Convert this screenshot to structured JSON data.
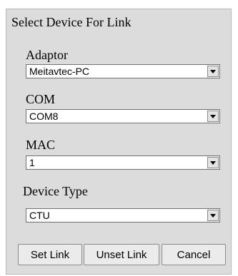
{
  "dialog": {
    "title": "Select Device For Link"
  },
  "fields": [
    {
      "label": "Adaptor",
      "value": "Meitavtec-PC"
    },
    {
      "label": "COM",
      "value": "COM8"
    },
    {
      "label": "MAC",
      "value": "1"
    },
    {
      "label": "Device Type",
      "value": "CTU"
    }
  ],
  "buttons": {
    "set_link": "Set Link",
    "unset_link": "Unset Link",
    "cancel": "Cancel"
  },
  "icons": {
    "dropdown": "chevron-down-icon"
  },
  "colors": {
    "panel_background": "#dcdcdc",
    "field_background": "#ffffff"
  }
}
